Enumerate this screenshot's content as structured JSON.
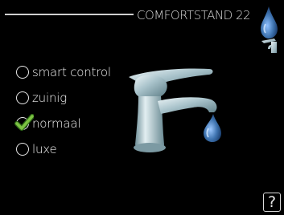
{
  "header": {
    "title": "COMFORTSTAND 22"
  },
  "options": [
    {
      "label": "smart control",
      "selected": false
    },
    {
      "label": "zuinig",
      "selected": false
    },
    {
      "label": "normaal",
      "selected": true
    },
    {
      "label": "luxe",
      "selected": false
    }
  ],
  "help": {
    "label": "?"
  },
  "icons": {
    "top": "tap-water-drop-icon",
    "main": "faucet-icon",
    "check": "checkmark-icon"
  },
  "colors": {
    "background": "#000000",
    "text": "#f2f2f2",
    "drop_blue": "#3f74b0",
    "check_green": "#7cc243"
  }
}
